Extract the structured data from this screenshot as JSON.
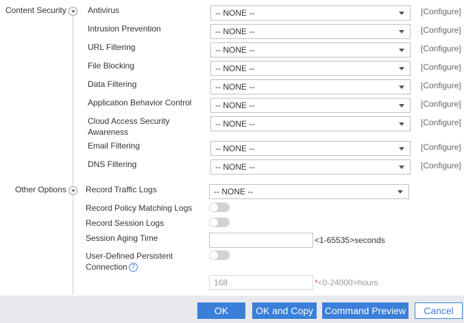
{
  "content_security": {
    "section_label": "Content Security",
    "configure_label": "[Configure]",
    "rows": [
      {
        "label": "Antivirus",
        "value": "-- NONE --"
      },
      {
        "label": "Intrusion Prevention",
        "value": "-- NONE --"
      },
      {
        "label": "URL Filtering",
        "value": "-- NONE --"
      },
      {
        "label": "File Blocking",
        "value": "-- NONE --"
      },
      {
        "label": "Data Filtering",
        "value": "-- NONE --"
      },
      {
        "label": "Application Behavior Control",
        "value": "-- NONE --"
      },
      {
        "label_line1": "Cloud Access Security",
        "label_line2": "Awareness",
        "value": "-- NONE --"
      },
      {
        "label": "Email Filtering",
        "value": "-- NONE --"
      },
      {
        "label": "DNS Filtering",
        "value": "-- NONE --"
      }
    ]
  },
  "other_options": {
    "section_label": "Other Options",
    "record_traffic_logs": {
      "label": "Record Traffic Logs",
      "value": "-- NONE --"
    },
    "record_policy_matching_logs": {
      "label": "Record Policy Matching Logs",
      "enabled": false
    },
    "record_session_logs": {
      "label": "Record Session Logs",
      "enabled": false
    },
    "session_aging_time": {
      "label": "Session Aging Time",
      "value": "",
      "hint": "<1-65535>seconds"
    },
    "persistent_connection": {
      "label_line1": "User-Defined Persistent",
      "label_line2": "Connection",
      "enabled": false,
      "help_icon": "?"
    },
    "persistent_hours": {
      "value": "168",
      "required_mark": "*",
      "hint": "<0-24000>hours"
    }
  },
  "footer": {
    "ok": "OK",
    "ok_and_copy": "OK and Copy",
    "command_preview": "Command Preview",
    "cancel": "Cancel"
  },
  "colors": {
    "accent": "#3a7fd9",
    "footer_bg": "#e7e9ec",
    "required": "#e04040"
  }
}
